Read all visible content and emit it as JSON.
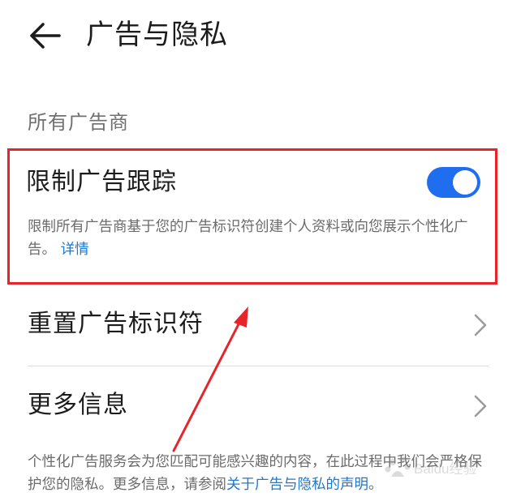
{
  "header": {
    "title": "广告与隐私",
    "back_icon": "arrow-left-icon"
  },
  "section_label": "所有广告商",
  "limit_tracking": {
    "title": "限制广告跟踪",
    "enabled": true,
    "description": "限制所有广告商基于您的广告标识符创建个人资料或向您展示个性化广告。",
    "detail_link": "详情"
  },
  "rows": [
    {
      "label": "重置广告标识符",
      "icon": "chevron-right-icon"
    },
    {
      "label": "更多信息",
      "icon": "chevron-right-icon"
    }
  ],
  "footer": {
    "text": "个性化广告服务会为您匹配可能感兴趣的内容，在此过程中我们会严格保护您的隐私。更多信息，请参阅",
    "link": "关于广告与隐私的声明",
    "end": "。"
  },
  "colors": {
    "accent": "#1f6ef0",
    "link": "#1f78d1",
    "annotation": "#e8242b"
  },
  "watermark": "Baidu经验"
}
